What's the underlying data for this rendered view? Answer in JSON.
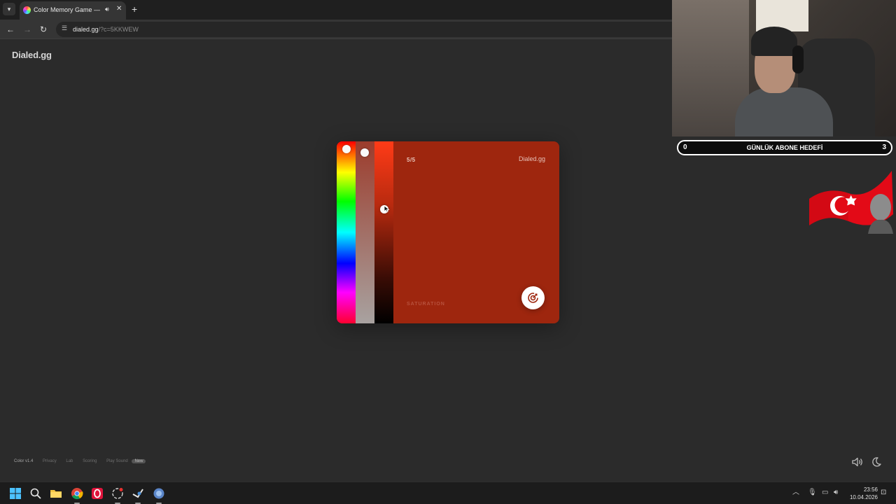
{
  "browser": {
    "tab_title": "Color Memory Game — Ho",
    "url_host": "dialed.gg",
    "url_path": "/?c=5KKWEW"
  },
  "page": {
    "brand": "Dialed.gg"
  },
  "game": {
    "round_counter": "5/5",
    "card_brand": "Dialed.gg",
    "mode_label": "SATURATION",
    "current_color": "#9e260e"
  },
  "footer": {
    "version": "Color v1.4",
    "links": [
      "Privacy",
      "Lab",
      "Scoring",
      "Play Sound"
    ],
    "new_badge": "New"
  },
  "overlay": {
    "goal_current": "0",
    "goal_title": "GÜNLÜK ABONE HEDEFİ",
    "goal_target": "3"
  },
  "taskbar": {
    "time": "23:56",
    "date": "10.04.2026"
  },
  "icons": [
    "windows-icon",
    "search-icon",
    "folder-icon",
    "chrome-icon",
    "opera-icon",
    "steam-icon",
    "app-icon",
    "sound-icon",
    "moon-icon",
    "submit-target-icon"
  ]
}
